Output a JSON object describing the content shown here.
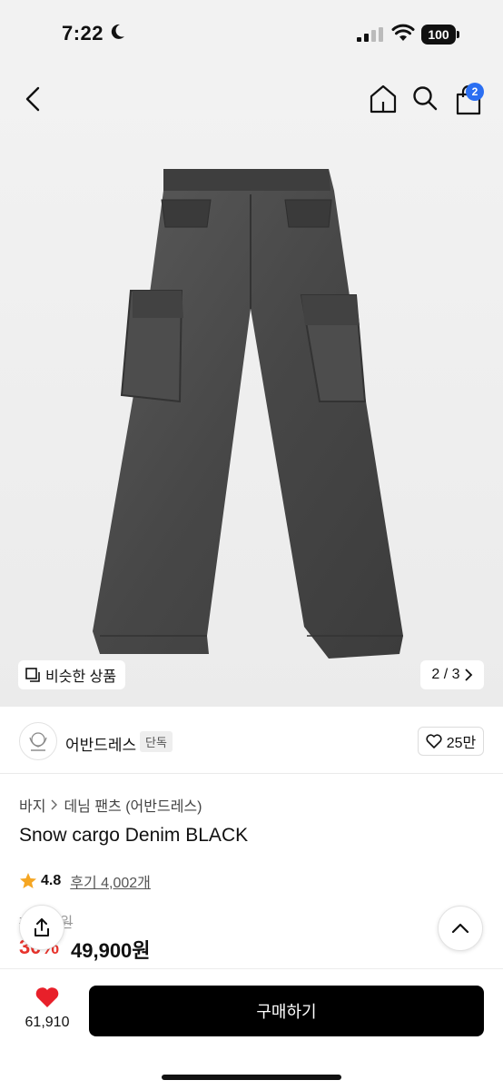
{
  "status_bar": {
    "time": "7:22",
    "battery": "100"
  },
  "nav": {
    "cart_count": "2",
    "icons": [
      "back-chevron-icon",
      "home-icon",
      "search-icon",
      "shopping-bag-icon"
    ]
  },
  "gallery": {
    "similar_label": "비슷한 상품",
    "pager": "2 / 3"
  },
  "brand": {
    "name": "어반드레스",
    "tag": "단독",
    "likes": "25만"
  },
  "breadcrumb": {
    "items": [
      "바지",
      "데님 팬츠 (어반드레스)"
    ]
  },
  "product": {
    "title": "Snow cargo Denim BLACK",
    "rating": "4.8",
    "reviews": "후기 4,002개",
    "original_price": "7 ,900원",
    "discount": "30%",
    "price": "49,900원"
  },
  "bottom_bar": {
    "heart_count": "61,910",
    "buy_label": "구매하기"
  },
  "colors": {
    "accent_blue": "#2b6ff2",
    "discount_red": "#e8332c",
    "heart_red": "#e8202a",
    "star": "#f5a623"
  }
}
